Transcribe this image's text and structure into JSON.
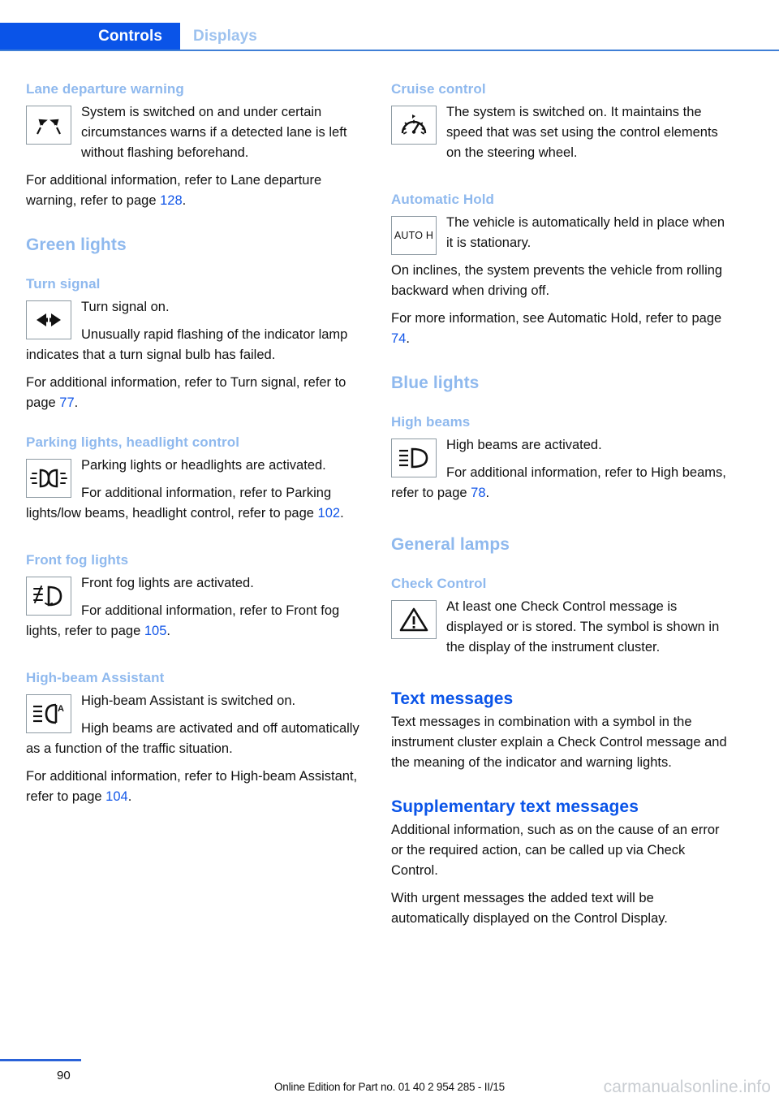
{
  "header": {
    "active_tab": "Controls",
    "inactive_tab": "Displays",
    "active_tab_color": "#0a54e8",
    "inactive_tab_color": "#9dc2ef"
  },
  "colors": {
    "heading_blue": "#8fb9ee",
    "strong_blue": "#0a54e8",
    "page_ref_blue": "#1256e8",
    "rule_blue": "#3f7fd6",
    "body_text": "#111111",
    "watermark": "#c9cdd2"
  },
  "left_column": {
    "lane_departure": {
      "heading": "Lane departure warning",
      "icon": "lane-departure-warning-icon",
      "para1": "System is switched on and under certain circumstances warns if a detected lane is left without flashing beforehand.",
      "para2_pre": "For additional information, refer to Lane departure warning, refer to page ",
      "para2_page": "128",
      "para2_post": "."
    },
    "green_lights_heading": "Green lights",
    "turn_signal": {
      "heading": "Turn signal",
      "icon": "turn-signal-icon",
      "para1": "Turn signal on.",
      "para2": "Unusually rapid flashing of the indicator lamp indicates that a turn signal bulb has failed.",
      "para3_pre": "For additional information, refer to Turn signal, refer to page ",
      "para3_page": "77",
      "para3_post": "."
    },
    "parking_lights": {
      "heading": "Parking lights, headlight control",
      "icon": "parking-lights-icon",
      "para1": "Parking lights or headlights are activated.",
      "para2_pre": "For additional information, refer to Parking lights/low beams, headlight control, refer to page ",
      "para2_page": "102",
      "para2_post": "."
    },
    "front_fog_lights": {
      "heading": "Front fog lights",
      "icon": "front-fog-lights-icon",
      "para1": "Front fog lights are activated.",
      "para2_pre": "For additional information, refer to Front fog lights, refer to page ",
      "para2_page": "105",
      "para2_post": "."
    },
    "high_beam_assistant": {
      "heading": "High-beam Assistant",
      "icon": "high-beam-assistant-icon",
      "para1": "High-beam Assistant is switched on.",
      "para2": "High beams are activated and off automatically as a function of the traffic situation.",
      "para3_pre": "For additional information, refer to High-beam Assistant, refer to page ",
      "para3_page": "104",
      "para3_post": "."
    }
  },
  "right_column": {
    "cruise_control": {
      "heading": "Cruise control",
      "icon": "cruise-control-icon",
      "para1": "The system is switched on. It maintains the speed that was set using the control elements on the steering wheel."
    },
    "automatic_hold": {
      "heading": "Automatic Hold",
      "icon": "automatic-hold-icon",
      "icon_label": "AUTO H",
      "para1": "The vehicle is automatically held in place when it is stationary.",
      "para2": "On inclines, the system prevents the vehicle from rolling backward when driving off.",
      "para3_pre": "For more information, see Automatic Hold, refer to page ",
      "para3_page": "74",
      "para3_post": "."
    },
    "blue_lights_heading": "Blue lights",
    "high_beams": {
      "heading": "High beams",
      "icon": "high-beams-icon",
      "para1": "High beams are activated.",
      "para2_pre": "For additional information, refer to High beams, refer to page ",
      "para2_page": "78",
      "para2_post": "."
    },
    "general_lamps_heading": "General lamps",
    "check_control": {
      "heading": "Check Control",
      "icon": "warning-triangle-icon",
      "para1": "At least one Check Control message is displayed or is stored. The symbol is shown in the display of the instrument cluster."
    },
    "text_messages": {
      "heading": "Text messages",
      "para1": "Text messages in combination with a symbol in the instrument cluster explain a Check Control message and the meaning of the indicator and warning lights."
    },
    "supplementary_text_messages": {
      "heading": "Supplementary text messages",
      "para1": "Additional information, such as on the cause of an error or the required action, can be called up via Check Control.",
      "para2": "With urgent messages the added text will be automatically displayed on the Control Display."
    }
  },
  "footer": {
    "page_number": "90",
    "edition_line": "Online Edition for Part no. 01 40 2 954 285 - II/15",
    "watermark": "carmanualsonline.info"
  }
}
